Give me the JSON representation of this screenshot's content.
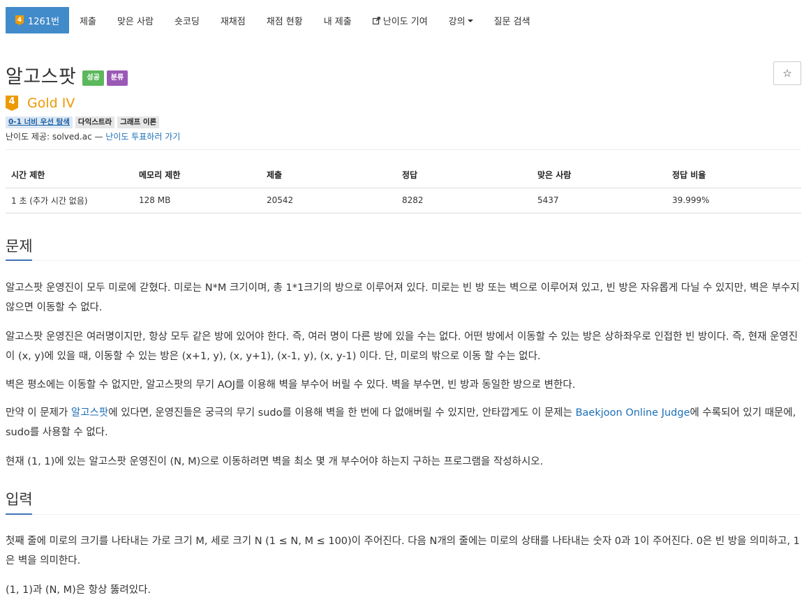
{
  "nav": {
    "items": [
      {
        "label": "1261번",
        "tier_num": "4"
      },
      {
        "label": "제출"
      },
      {
        "label": "맞은 사람"
      },
      {
        "label": "숏코딩"
      },
      {
        "label": "재채점"
      },
      {
        "label": "채점 현황"
      },
      {
        "label": "내 제출"
      },
      {
        "label": "난이도 기여"
      },
      {
        "label": "강의"
      },
      {
        "label": "질문 검색"
      }
    ]
  },
  "problem": {
    "title": "알고스팟",
    "badges": {
      "success": "성공",
      "category": "분류"
    },
    "star": "☆",
    "tier": {
      "num": "4",
      "label": "Gold IV",
      "color": "#ec9a00"
    },
    "tags": [
      "0-1 너비 우선 탐색",
      "다익스트라",
      "그래프 이론"
    ],
    "difficulty_prefix": "난이도 제공: solved.ac — ",
    "difficulty_link": "난이도 투표하러 가기"
  },
  "info": {
    "headers": [
      "시간 제한",
      "메모리 제한",
      "제출",
      "정답",
      "맞은 사람",
      "정답 비율"
    ],
    "values": [
      "1 초 (추가 시간 없음)",
      "128 MB",
      "20542",
      "8282",
      "5437",
      "39.999%"
    ]
  },
  "sections": {
    "problem_heading": "문제",
    "input_heading": "입력",
    "p1": "알고스팟 운영진이 모두 미로에 갇혔다. 미로는 N*M 크기이며, 총 1*1크기의 방으로 이루어져 있다. 미로는 빈 방 또는 벽으로 이루어져 있고, 빈 방은 자유롭게 다닐 수 있지만, 벽은 부수지 않으면 이동할 수 없다.",
    "p2": "알고스팟 운영진은 여러명이지만, 항상 모두 같은 방에 있어야 한다. 즉, 여러 명이 다른 방에 있을 수는 없다. 어떤 방에서 이동할 수 있는 방은 상하좌우로 인접한 빈 방이다. 즉, 현재 운영진이 (x, y)에 있을 때, 이동할 수 있는 방은 (x+1, y), (x, y+1), (x-1, y), (x, y-1) 이다. 단, 미로의 밖으로 이동 할 수는 없다.",
    "p3": "벽은 평소에는 이동할 수 없지만, 알고스팟의 무기 AOJ를 이용해 벽을 부수어 버릴 수 있다. 벽을 부수면, 빈 방과 동일한 방으로 변한다.",
    "p4_a": "만약 이 문제가 ",
    "p4_link1": "알고스팟",
    "p4_b": "에 있다면, 운영진들은 궁극의 무기 sudo를 이용해 벽을 한 번에 다 없애버릴 수 있지만, 안타깝게도 이 문제는 ",
    "p4_link2": "Baekjoon Online Judge",
    "p4_c": "에 수록되어 있기 때문에, sudo를 사용할 수 없다.",
    "p5": "현재 (1, 1)에 있는 알고스팟 운영진이 (N, M)으로 이동하려면 벽을 최소 몇 개 부수어야 하는지 구하는 프로그램을 작성하시오.",
    "in1": "첫째 줄에 미로의 크기를 나타내는 가로 크기 M, 세로 크기 N (1 ≤ N, M ≤ 100)이 주어진다. 다음 N개의 줄에는 미로의 상태를 나타내는 숫자 0과 1이 주어진다. 0은 빈 방을 의미하고, 1은 벽을 의미한다.",
    "in2": "(1, 1)과 (N, M)은 항상 뚫려있다."
  },
  "colors": {
    "nav_active": "#428bca",
    "link": "#1b6eb6",
    "gold": "#ec9a00",
    "success": "#5cb85c",
    "category": "#9b59b6"
  }
}
